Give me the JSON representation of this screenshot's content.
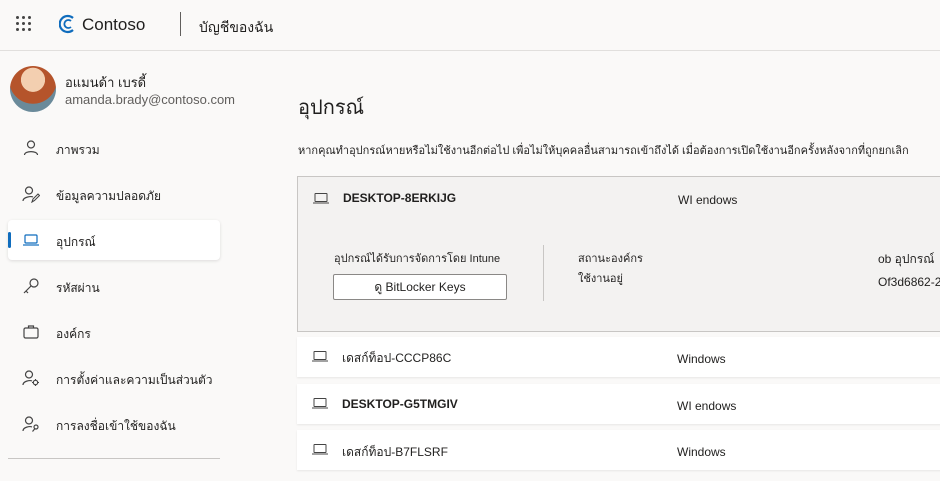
{
  "header": {
    "brand": "Contoso",
    "section_title": "บัญชีของฉัน"
  },
  "profile": {
    "name": "อแมนด้า เบรดี้",
    "email": "amanda.brady@contoso.com"
  },
  "nav": {
    "items": [
      {
        "label": "ภาพรวม",
        "icon": "person-icon",
        "active": false
      },
      {
        "label": "ข้อมูลความปลอดภัย",
        "icon": "person-edit-icon",
        "active": false
      },
      {
        "label": "อุปกรณ์",
        "icon": "laptop-icon",
        "active": true
      },
      {
        "label": "รหัสผ่าน",
        "icon": "key-icon",
        "active": false
      },
      {
        "label": "องค์กร",
        "icon": "briefcase-icon",
        "active": false
      },
      {
        "label": "การตั้งค่าและความเป็นส่วนตัว",
        "icon": "person-settings-icon",
        "active": false
      },
      {
        "label": "การลงชื่อเข้าใช้ของฉัน",
        "icon": "person-key-icon",
        "active": false
      }
    ]
  },
  "main": {
    "title": "อุปกรณ์",
    "description": "หากคุณทำอุปกรณ์หายหรือไม่ใช้งานอีกต่อไป เพื่อไม่ให้บุคคลอื่นสามารถเข้าถึงได้ เมื่อต้องการเปิดใช้งานอีกครั้งหลังจากที่ถูกยกเลิก",
    "expanded_device": {
      "name": "DESKTOP-8ERKIJG",
      "os": "WI endows",
      "managed_label": "อุปกรณ์ได้รับการจัดการโดย Intune",
      "bitlocker_button": "ดู BitLocker Keys",
      "org_status_label": "สถานะองค์กร",
      "org_status_value": "ใช้งานอยู่",
      "device_id_label": "ob อุปกรณ์",
      "device_id_value": "Of3d6862-2"
    },
    "devices": [
      {
        "name": "เดสก์ท็อป-CCCP86C",
        "os": "Windows",
        "bold": false
      },
      {
        "name": "DESKTOP-G5TMGIV",
        "os": "WI endows",
        "bold": true
      },
      {
        "name": "เดสก์ท็อป-B7FLSRF",
        "os": "Windows",
        "bold": false
      }
    ]
  },
  "colors": {
    "accent": "#0f6cbd",
    "background": "#faf9f8",
    "card": "#ffffff",
    "expanded_card": "#f3f2f1"
  }
}
